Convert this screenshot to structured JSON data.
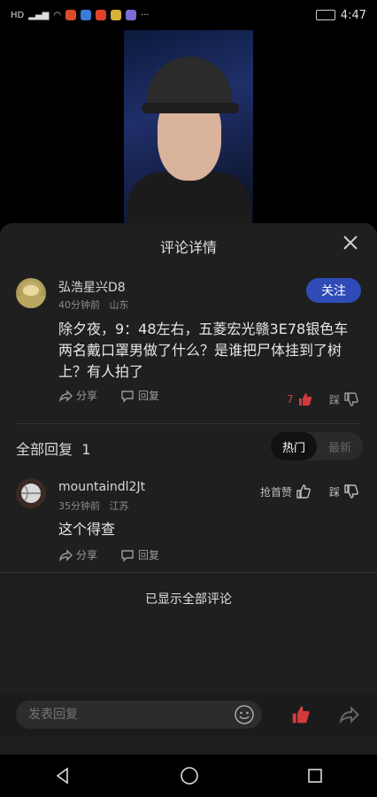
{
  "status": {
    "left": "HD",
    "time": "4:47"
  },
  "sheet": {
    "title": "评论详情"
  },
  "comment": {
    "author": "弘浩星兴D8",
    "time": "40分钟前",
    "location": "山东",
    "follow_label": "关注",
    "text": "除夕夜，9：48左右，五菱宏光赣3E78银色车两名戴口罩男做了什么？是谁把尸体挂到了树上？有人拍了",
    "share_label": "分享",
    "reply_label": "回复",
    "likes": "7",
    "dislike_label": "踩"
  },
  "replies": {
    "title": "全部回复",
    "count": "1",
    "tabs": [
      "热门",
      "最新"
    ],
    "items": [
      {
        "author": "mountaindl2Jt",
        "time": "35分钟前",
        "location": "江苏",
        "text": "这个得查",
        "first_like_label": "抢首赞",
        "dislike_label": "踩",
        "share_label": "分享",
        "reply_label": "回复"
      }
    ]
  },
  "end_text": "已显示全部评论",
  "input": {
    "placeholder": "发表回复"
  },
  "colors": {
    "accent": "#2e4bb8",
    "like_red": "#d23b3b",
    "sheet_bg": "#1f1f1f"
  }
}
